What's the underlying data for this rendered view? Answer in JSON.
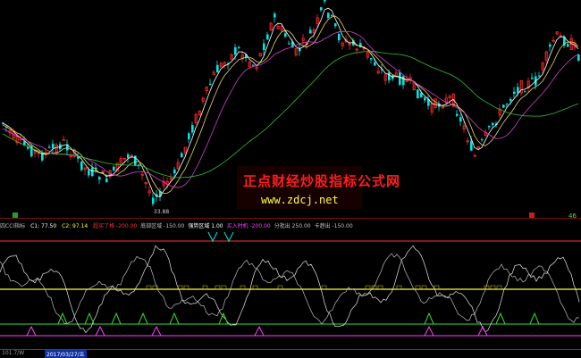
{
  "watermark": {
    "title": "正点财经炒股指标公式网",
    "url": "www.zdcj.net"
  },
  "price_chart": {
    "low_label": "33.88",
    "top_right_tag": "46"
  },
  "indicator": {
    "name": "四CCI指标",
    "c1": "C1: 77.50",
    "c2": "C2: 97.14",
    "labels": [
      {
        "text": "超买了格 -200.00",
        "color": "#ff3030"
      },
      {
        "text": "底部区域 -150.00",
        "color": "#c0c0c0"
      },
      {
        "text": "强势区域 1.00",
        "color": "#ffffff"
      },
      {
        "text": "买入时机 -200.00",
        "color": "#ff40ff"
      },
      {
        "text": "分批出 250.00",
        "color": "#c0c0c0"
      },
      {
        "text": "卡趋出 -150.00",
        "color": "#c0c0c0"
      }
    ]
  },
  "footer": {
    "time_label": "101.7/W",
    "date_label": "2017/03/27/五"
  },
  "colors": {
    "up": "#ff2a2a",
    "down": "#00e5e5",
    "ma1": "#ffffff",
    "ma2": "#e8d860",
    "ma3": "#d040d0",
    "ma4": "#30c030",
    "yellow_line": "#ffff40",
    "green_line": "#30e030",
    "magenta_line": "#ff40ff",
    "red_line": "#ff3030"
  }
}
